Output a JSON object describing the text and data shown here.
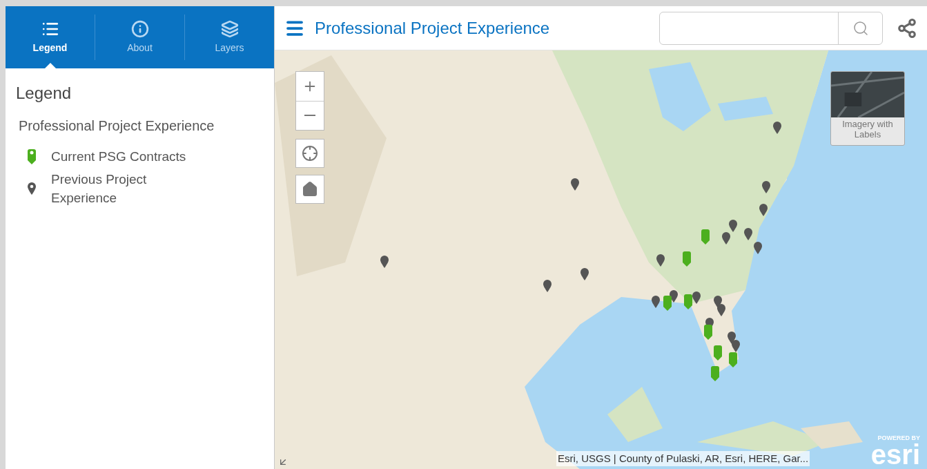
{
  "sidebar": {
    "tabs": [
      {
        "label": "Legend",
        "selected": true
      },
      {
        "label": "About",
        "selected": false
      },
      {
        "label": "Layers",
        "selected": false
      }
    ],
    "legend": {
      "title": "Legend",
      "layer_title": "Professional Project Experience",
      "items": [
        {
          "kind": "current",
          "label": "Current PSG Contracts"
        },
        {
          "kind": "previous",
          "label": "Previous Project Experience"
        }
      ]
    }
  },
  "header": {
    "title": "Professional Project Experience"
  },
  "map": {
    "basemap_toggle": {
      "label": "Imagery with Labels"
    },
    "attribution": "Esri, USGS | County of Pulaski, AR, Esri, HERE, Gar...",
    "logo": {
      "caption": "POWERED BY",
      "wordmark": "esri"
    }
  }
}
